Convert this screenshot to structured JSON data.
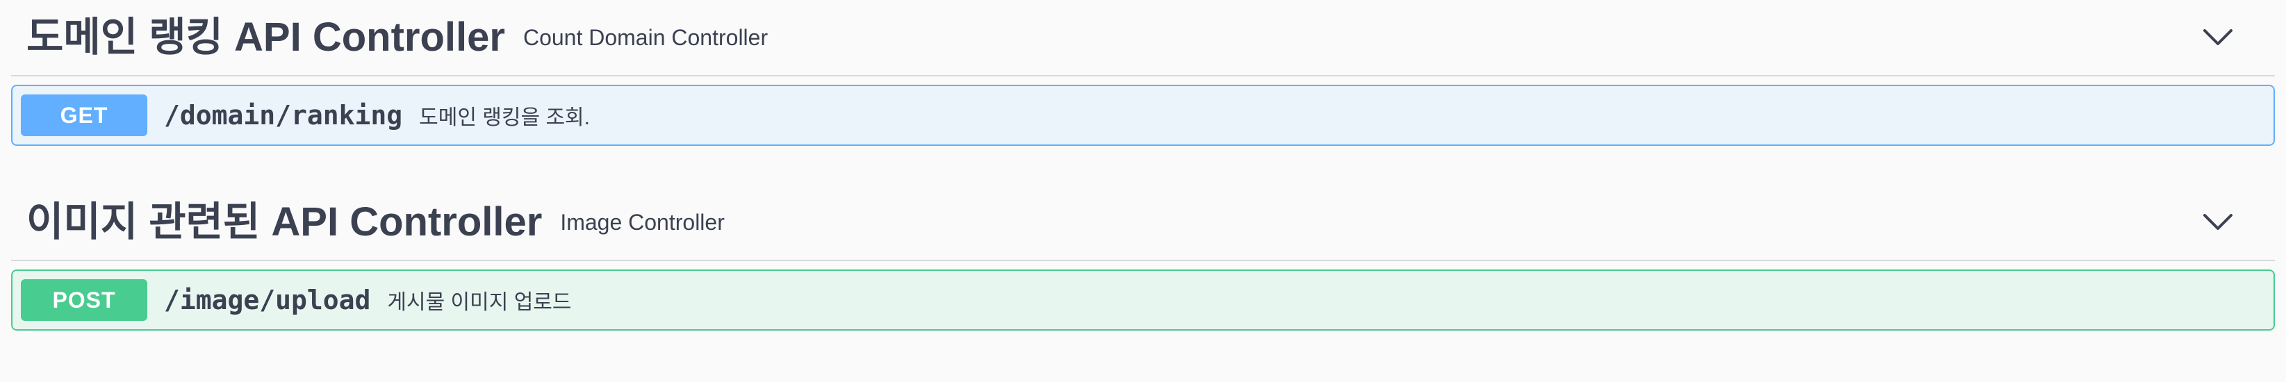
{
  "sections": [
    {
      "title": "도메인 랭킹 API Controller",
      "description": "Count Domain Controller",
      "operation": {
        "method": "GET",
        "path": "/domain/ranking",
        "summary": "도메인 랭킹을 조회."
      }
    },
    {
      "title": "이미지 관련된 API Controller",
      "description": "Image Controller",
      "operation": {
        "method": "POST",
        "path": "/image/upload",
        "summary": "게시물 이미지 업로드"
      }
    }
  ],
  "icons": {
    "toggle": "chevron-down-icon"
  },
  "colors": {
    "get": "#61affe",
    "post": "#49cc90",
    "text": "#3b4151"
  }
}
